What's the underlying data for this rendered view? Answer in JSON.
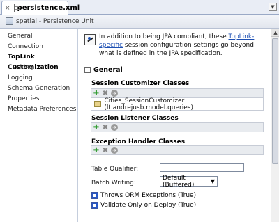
{
  "editor_tab": {
    "title": "persistence.xml",
    "close": "×",
    "overflow": "▼"
  },
  "header": {
    "title": "spatial - Persistence Unit"
  },
  "sidebar": {
    "items": [
      {
        "label": "General",
        "active": false
      },
      {
        "label": "Connection",
        "active": false
      },
      {
        "label": "TopLink Customization",
        "active": true
      },
      {
        "label": "Caching",
        "active": false
      },
      {
        "label": "Logging",
        "active": false
      },
      {
        "label": "Schema Generation",
        "active": false
      },
      {
        "label": "Properties",
        "active": false
      },
      {
        "label": "Metadata Preferences",
        "active": false
      }
    ]
  },
  "intro": {
    "text_before": "In addition to being JPA compliant, these ",
    "link": "TopLink-specific",
    "text_after": " session configuration settings go beyond what is defined in the JPA specification."
  },
  "general": {
    "toggle": "−",
    "title": "General",
    "session_customizer": {
      "label": "Session Customizer Classes",
      "item": "Cities_SessionCustomizer (lt.andrejusb.model.queries)"
    },
    "session_listener": {
      "label": "Session Listener Classes"
    },
    "exception_handler": {
      "label": "Exception Handler Classes"
    },
    "toolbar_icons": {
      "add": "✚",
      "remove": "✖",
      "edit": "➔"
    },
    "table_qualifier": {
      "label": "Table Qualifier:",
      "value": ""
    },
    "batch_writing": {
      "label": "Batch Writing:",
      "value": "Default (Buffered)",
      "caret": "▼"
    },
    "throws_orm": {
      "label": "Throws ORM Exceptions (True)",
      "checked": true
    },
    "validate_only": {
      "label": "Validate Only on Deploy (True)",
      "checked": true
    }
  },
  "scrollbar": {
    "up_arrow": "▲"
  }
}
